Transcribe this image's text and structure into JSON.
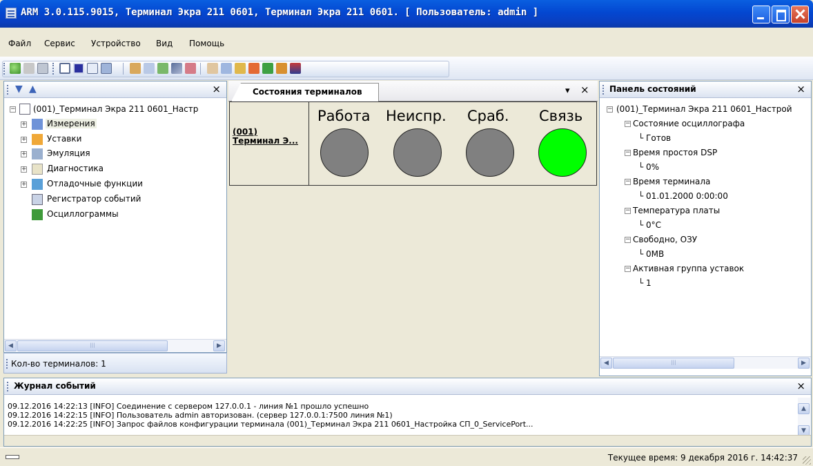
{
  "window": {
    "title": "ARM 3.0.115.9015, Терминал Экра 211 0601, Терминал Экра 211 0601. [ Пользователь: admin ]"
  },
  "menu": [
    "Файл",
    "Сервис",
    "Устройство",
    "Вид",
    "Помощь"
  ],
  "left_panel": {
    "tree_root": "(001)_Терминал Экра 211 0601_Настр",
    "items": [
      "Измерения",
      "Уставки",
      "Эмуляция",
      "Диагностика",
      "Отладочные функции",
      "Регистратор событий",
      "Осциллограммы"
    ],
    "count_label": "Кол-во терминалов: 1",
    "scroll_grip": "|||"
  },
  "center": {
    "tab_title": "Состояния терминалов",
    "terminal_code": "(001)",
    "terminal_name": "Терминал Э...",
    "columns": [
      "Работа",
      "Неиспр.",
      "Сраб.",
      "Связь"
    ],
    "lamp_colors": [
      "#808080",
      "#808080",
      "#808080",
      "#00FF00"
    ]
  },
  "right_panel": {
    "title": "Панель состояний",
    "root": "(001)_Терминал Экра 211 0601_Настрой",
    "nodes": [
      {
        "name": "Состояние осциллографа",
        "value": "Готов"
      },
      {
        "name": "Время простоя DSP",
        "value": "0%"
      },
      {
        "name": "Время терминала",
        "value": "01.01.2000 0:00:00"
      },
      {
        "name": "Температура платы",
        "value": "0°С"
      },
      {
        "name": "Свободно, ОЗУ",
        "value": "0MB"
      },
      {
        "name": "Активная группа уставок",
        "value": "1"
      }
    ],
    "scroll_grip": "|||"
  },
  "journal": {
    "title": "Журнал событий",
    "lines": [
      "09.12.2016 14:22:13 [INFO] Соединение с сервером 127.0.0.1 - линия №1 прошло успешно",
      "09.12.2016 14:22:15 [INFO] Пользователь admin авторизован. (сервер 127.0.0.1:7500 линия №1)",
      "09.12.2016 14:22:25 [INFO] Запрос файлов конфигурации терминала (001)_Терминал Экра 211 0601_Настройка СП_0_ServicePort..."
    ]
  },
  "status": {
    "time": "Текущее время: 9 декабря 2016 г. 14:42:37"
  },
  "glyphs": {
    "close": "×",
    "down": "▾",
    "left": "◀",
    "right": "▶",
    "up": "▲",
    "dn": "▼",
    "minus": "−",
    "plus": "+"
  }
}
